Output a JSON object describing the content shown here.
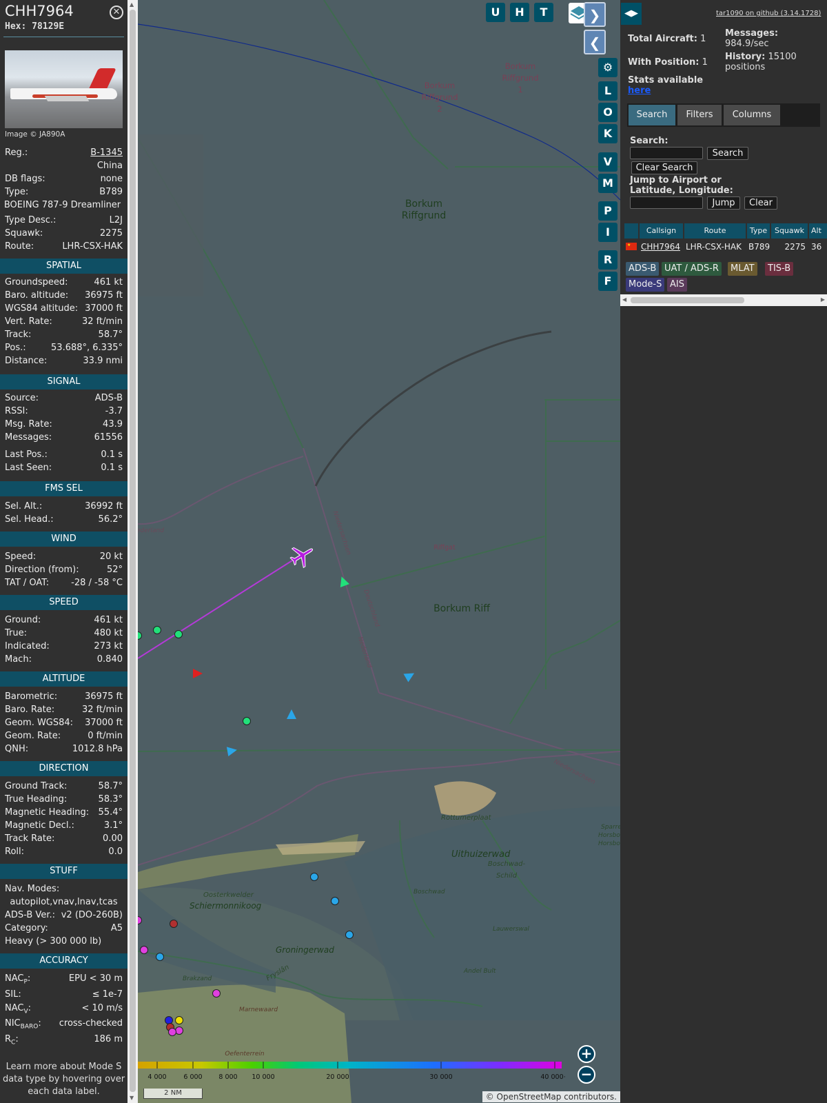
{
  "info": {
    "callsign": "CHH7964",
    "hex_label": "Hex:",
    "hex": "78129E",
    "image_credit": "Image © JA890A",
    "reg_label": "Reg.:",
    "reg": "B-1345",
    "country": "China",
    "dbflags_label": "DB flags:",
    "dbflags": "none",
    "type_label": "Type:",
    "type": "B789",
    "type_full": "BOEING 787-9 Dreamliner",
    "typedesc_label": "Type Desc.:",
    "typedesc": "L2J",
    "squawk_label": "Squawk:",
    "squawk": "2275",
    "route_label": "Route:",
    "route": "LHR-CSX-HAK",
    "spatial": {
      "header": "SPATIAL",
      "rows": [
        {
          "label": "Groundspeed:",
          "value": "461 kt"
        },
        {
          "label": "Baro. altitude:",
          "value": "36975 ft"
        },
        {
          "label": "WGS84 altitude:",
          "value": "37000 ft"
        },
        {
          "label": "Vert. Rate:",
          "value": "32 ft/min"
        },
        {
          "label": "Track:",
          "value": "58.7°"
        },
        {
          "label": "Pos.:",
          "value": "53.688°, 6.335°"
        },
        {
          "label": "Distance:",
          "value": "33.9 nmi"
        }
      ]
    },
    "signal": {
      "header": "SIGNAL",
      "rows": [
        {
          "label": "Source:",
          "value": "ADS-B"
        },
        {
          "label": "RSSI:",
          "value": "-3.7"
        },
        {
          "label": "Msg. Rate:",
          "value": "43.9"
        },
        {
          "label": "Messages:",
          "value": "61556"
        },
        {
          "label": "Last Pos.:",
          "value": "0.1 s"
        },
        {
          "label": "Last Seen:",
          "value": "0.1 s"
        }
      ]
    },
    "fms": {
      "header": "FMS SEL",
      "rows": [
        {
          "label": "Sel. Alt.:",
          "value": "36992 ft"
        },
        {
          "label": "Sel. Head.:",
          "value": "56.2°"
        }
      ]
    },
    "wind": {
      "header": "WIND",
      "rows": [
        {
          "label": "Speed:",
          "value": "20 kt"
        },
        {
          "label": "Direction (from):",
          "value": "52°"
        },
        {
          "label": "TAT / OAT:",
          "value": "-28 / -58 °C"
        }
      ]
    },
    "speed": {
      "header": "SPEED",
      "rows": [
        {
          "label": "Ground:",
          "value": "461 kt"
        },
        {
          "label": "True:",
          "value": "480 kt"
        },
        {
          "label": "Indicated:",
          "value": "273 kt"
        },
        {
          "label": "Mach:",
          "value": "0.840"
        }
      ]
    },
    "altitude": {
      "header": "ALTITUDE",
      "rows": [
        {
          "label": "Barometric:",
          "value": "36975 ft"
        },
        {
          "label": "Baro. Rate:",
          "value": "32 ft/min"
        },
        {
          "label": "Geom. WGS84:",
          "value": "37000 ft"
        },
        {
          "label": "Geom. Rate:",
          "value": "0 ft/min"
        },
        {
          "label": "QNH:",
          "value": "1012.8 hPa"
        }
      ]
    },
    "direction": {
      "header": "DIRECTION",
      "rows": [
        {
          "label": "Ground Track:",
          "value": "58.7°"
        },
        {
          "label": "True Heading:",
          "value": "58.3°"
        },
        {
          "label": "Magnetic Heading:",
          "value": "55.4°"
        },
        {
          "label": "Magnetic Decl.:",
          "value": "3.1°"
        },
        {
          "label": "Track Rate:",
          "value": "0.00"
        },
        {
          "label": "Roll:",
          "value": "0.0"
        }
      ]
    },
    "stuff": {
      "header": "STUFF",
      "navmodes_label": "Nav. Modes:",
      "navmodes": "autopilot,vnav,lnav,tcas",
      "adsb_label": "ADS-B Ver.:",
      "adsb": "v2 (DO-260B)",
      "category_label": "Category:",
      "category": "A5",
      "wake": "Heavy (> 300 000 lb)"
    },
    "accuracy": {
      "header": "ACCURACY",
      "nacp_base": "NAC",
      "nacp_sub": "P",
      "nacp": "EPU < 30 m",
      "sil_label": "SIL:",
      "sil": "≤ 1e-7",
      "nacv_base": "NAC",
      "nacv_sub": "V",
      "nacv": "< 10 m/s",
      "nicbaro_base": "NIC",
      "nicbaro_sub": "BARO",
      "nicbaro": "cross-checked",
      "rc_base": "R",
      "rc_sub": "C",
      "rc": "186 m"
    },
    "footer": "Learn more about Mode S data type by hovering over each data label."
  },
  "map": {
    "buttons": [
      "U",
      "H",
      "T"
    ],
    "side_buttons": [
      "L",
      "O",
      "K",
      "V",
      "M",
      "P",
      "I",
      "R",
      "F"
    ],
    "labels": {
      "borkum_riffgrund": "Borkum Riffgrund",
      "borkum_riffgrund_2": "Borkum Riffgrund 2",
      "borkum_riffgrund_1": "Borkum Riffgrund 1",
      "riffgat": "Riffgat",
      "borkum_riff": "Borkum Riff",
      "niedersachsen": "Niedersachsen",
      "deutschland": "Deutschland",
      "nederland": "Nederland",
      "nederland_left": "ederland",
      "niedersachsen_2": "Niedersachsen",
      "rottumerplaat": "Rottumerplaat",
      "uithuizerwad": "Uithuizerwad",
      "boschwad_schild": "Boschwad-Schild",
      "boschwad": "Boschwad",
      "oosterkwelder": "Oosterkwelder",
      "schiermonnikoog": "Schiermonnikoog",
      "groningerwad": "Groningerwad",
      "lauwerswal": "Lauwerswal",
      "andel_bult": "Andel Bult",
      "brakzand": "Brakzand",
      "frysian": "Fryslân",
      "marnewaard": "Marnewaard",
      "oefenterrein": "Oefenterrein Marnewaard",
      "sparre": "Sparre",
      "horsbor": "Horsbor",
      "horsbor2": "Horsbor"
    },
    "altitude_ticks": [
      "4 000",
      "6 000",
      "8 000",
      "10 000",
      "20 000",
      "30 000",
      "40 000+"
    ],
    "scale": "2 NM",
    "attribution": "© OpenStreetMap contributors."
  },
  "side": {
    "github": "tar1090 on github (3.14.1728)",
    "total_aircraft_label": "Total Aircraft:",
    "total_aircraft": "1",
    "with_position_label": "With Position:",
    "with_position": "1",
    "stats_label": "Stats available",
    "stats_link": "here",
    "messages_label": "Messages:",
    "messages": "984.9/sec",
    "history_label": "History:",
    "history": "15100 positions",
    "tabs": [
      "Search",
      "Filters",
      "Columns"
    ],
    "search_label": "Search:",
    "search_button": "Search",
    "clear_search": "Clear Search",
    "jump_label": "Jump to Airport or Latitude, Longitude:",
    "jump_button": "Jump",
    "clear_button": "Clear",
    "table": {
      "headers": [
        "Callsign",
        "Route",
        "Type",
        "Squawk",
        "Alt"
      ],
      "row": {
        "callsign": "CHH7964",
        "route": "LHR-CSX-HAK",
        "type": "B789",
        "squawk": "2275",
        "alt": "36"
      }
    },
    "sources": [
      {
        "label": "ADS-B",
        "color": "#3a5a70"
      },
      {
        "label": "UAT / ADS-R",
        "color": "#2e5a3e"
      },
      {
        "label": "MLAT",
        "color": "#6a5a30"
      },
      {
        "label": "TIS-B",
        "color": "#6a2e3e"
      },
      {
        "label": "Mode-S",
        "color": "#3a3a7a"
      },
      {
        "label": "AIS",
        "color": "#5a3a5a"
      }
    ]
  }
}
